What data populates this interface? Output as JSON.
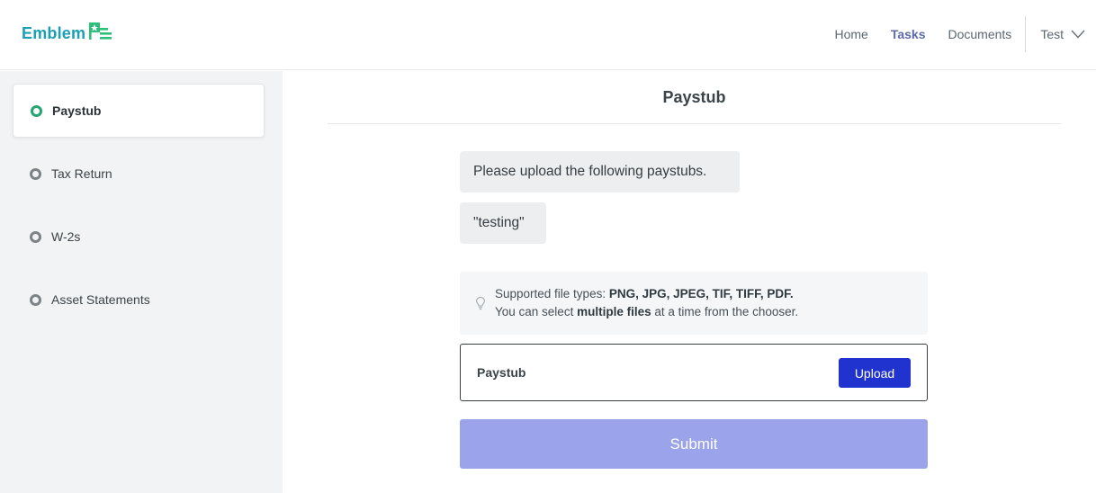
{
  "brand": {
    "name": "Emblem",
    "accent": "#1a9fb5",
    "mark_color": "#2bbf7a"
  },
  "nav": {
    "items": [
      {
        "label": "Home",
        "active": false
      },
      {
        "label": "Tasks",
        "active": true
      },
      {
        "label": "Documents",
        "active": false
      }
    ],
    "user": {
      "label": "Test",
      "icon": "chevron-down-icon"
    }
  },
  "sidebar": {
    "items": [
      {
        "label": "Paystub",
        "active": true
      },
      {
        "label": "Tax Return",
        "active": false
      },
      {
        "label": "W-2s",
        "active": false
      },
      {
        "label": "Asset Statements",
        "active": false
      }
    ]
  },
  "main": {
    "title": "Paystub",
    "messages": [
      "Please upload the following paystubs.",
      "\"testing\""
    ],
    "info": {
      "icon": "lightbulb-icon",
      "line1_prefix": "Supported file types: ",
      "line1_types": "PNG, JPG, JPEG, TIF, TIFF, PDF.",
      "line2_prefix": "You can select ",
      "line2_strong": "multiple files",
      "line2_suffix": " at a time from the chooser."
    },
    "upload": {
      "label": "Paystub",
      "button_label": "Upload"
    },
    "submit_label": "Submit"
  },
  "colors": {
    "primary_button": "#2133cf",
    "submit_disabled": "#9ba4ea",
    "active_dot": "#25a572",
    "nav_active": "#5f6aa8"
  }
}
